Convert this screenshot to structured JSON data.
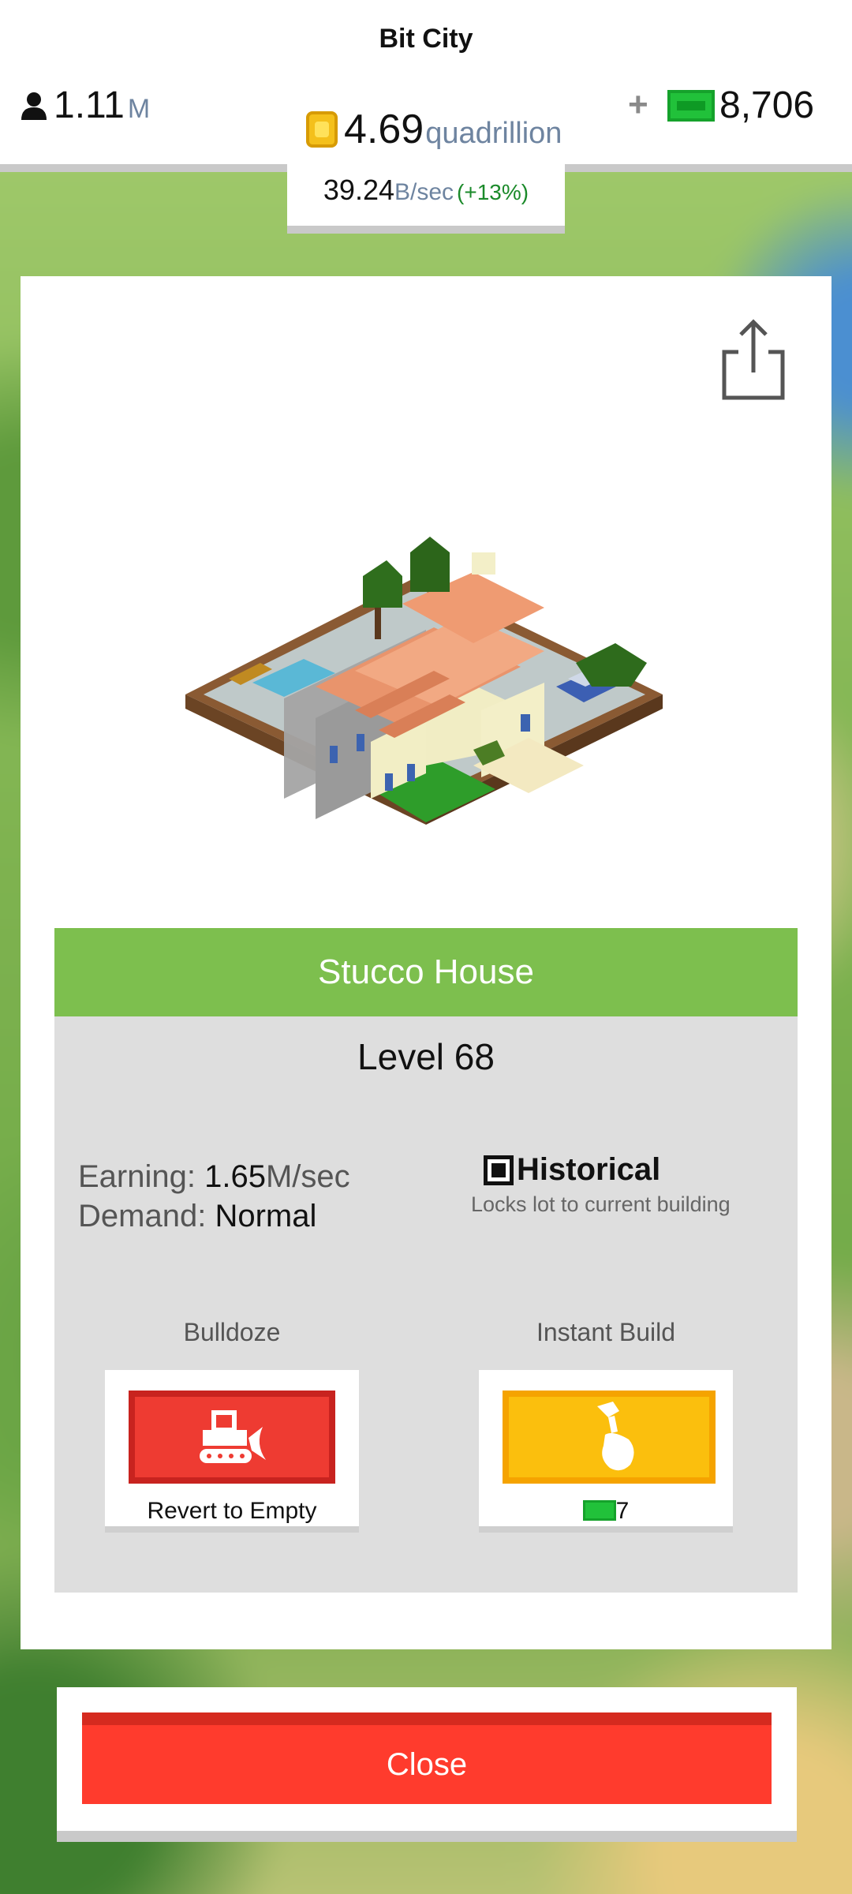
{
  "app": {
    "title": "Bit City"
  },
  "stats": {
    "population": "1.11",
    "population_unit": "M",
    "cash": "4.69",
    "cash_unit": "quadrillion",
    "plus": "+",
    "bux": "8,706",
    "rate": "39.24",
    "rate_unit": "B/sec",
    "rate_bonus": "(+13%)"
  },
  "building": {
    "name": "Stucco House",
    "level": "Level 68",
    "earning_label": "Earning:",
    "earning_value": "1.65",
    "earning_unit": "M/sec",
    "demand_label": "Demand:",
    "demand_value": "Normal",
    "historical_title": "Historical",
    "historical_sub": "Locks lot to current building"
  },
  "actions": {
    "bulldoze_label": "Bulldoze",
    "bulldoze_caption": "Revert to Empty",
    "instant_label": "Instant Build",
    "instant_cost": "7"
  },
  "close_label": "Close",
  "icons": {
    "population": "person-icon",
    "cash": "coin-icon",
    "bux": "bux-icon",
    "share": "share-icon",
    "bulldoze": "bulldozer-icon",
    "instant": "hammer-icon"
  },
  "colors": {
    "accent_green": "#7dbf4e",
    "danger_red": "#ee3b32",
    "warning_yellow": "#fbbf0d",
    "bux_green": "#21c13a"
  }
}
